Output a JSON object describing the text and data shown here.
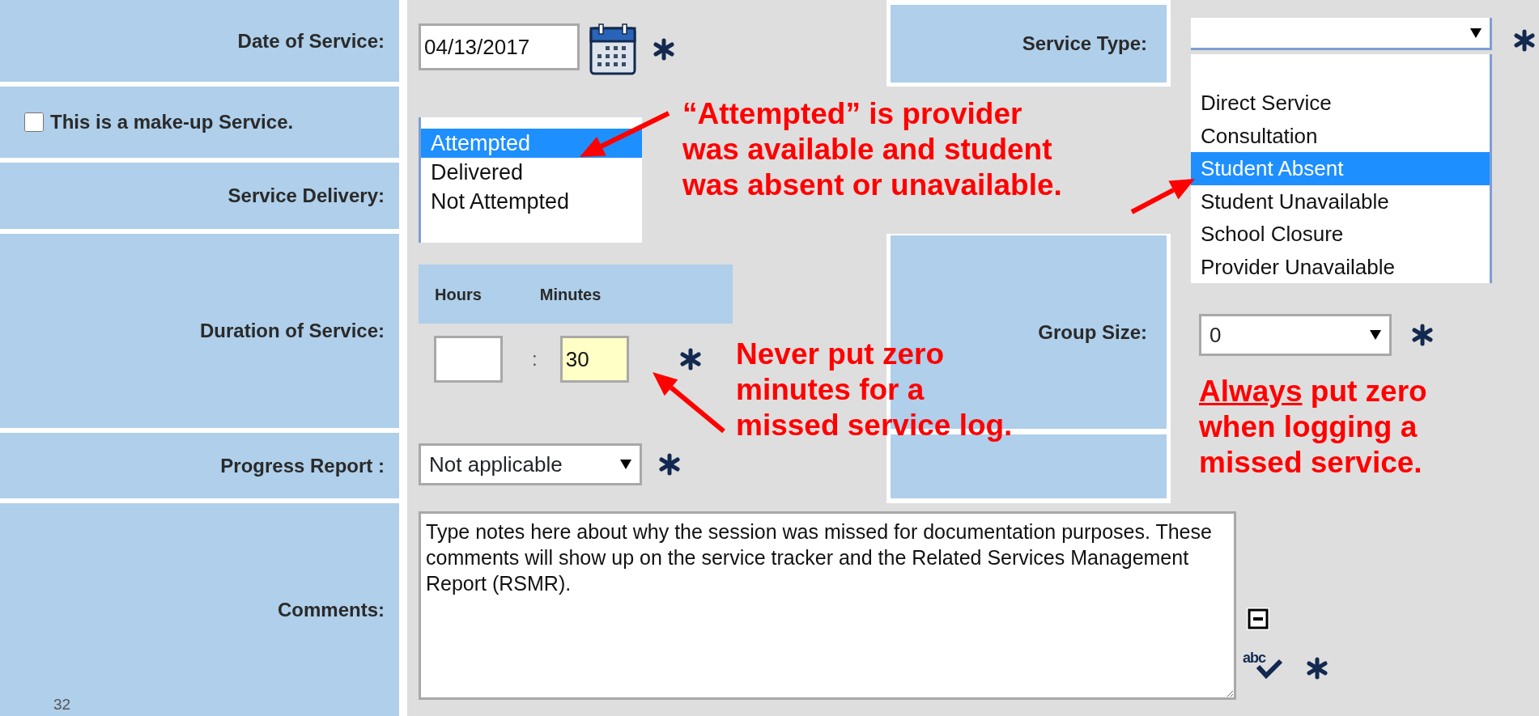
{
  "form": {
    "date_label": "Date of Service:",
    "date_value": "04/13/2017",
    "makeup": {
      "label": "This is a make-up Service.",
      "checked": false
    },
    "delivery_label": "Service Delivery:",
    "delivery_options": [
      {
        "label": "Attempted",
        "selected": true
      },
      {
        "label": "Delivered",
        "selected": false
      },
      {
        "label": "Not Attempted",
        "selected": false
      }
    ],
    "duration_label": "Duration of Service:",
    "hours_label": "Hours",
    "minutes_label": "Minutes",
    "separator": ":",
    "minutes_value": "30",
    "progress_label": "Progress Report :",
    "progress_value": "Not applicable",
    "comments_label": "Comments:",
    "comments_value": "Type notes here about why the session was missed for documentation purposes. These comments will show up on the service tracker and the Related Services Management Report (RSMR).",
    "spellcheck_label": "abc",
    "service_type_label": "Service Type:",
    "service_type_options": [
      {
        "label": "Direct Service",
        "selected": false
      },
      {
        "label": "Consultation",
        "selected": false
      },
      {
        "label": "Student Absent",
        "selected": true
      },
      {
        "label": "Student Unavailable",
        "selected": false
      },
      {
        "label": "School Closure",
        "selected": false
      },
      {
        "label": "Provider Unavailable",
        "selected": false
      }
    ],
    "group_size_label": "Group Size:",
    "group_size_value": "0"
  },
  "annotations": [
    {
      "lines": [
        "“Attempted” is provider",
        "was available and student",
        "was absent or unavailable."
      ]
    },
    {
      "lines": [
        "Never put zero",
        "minutes for a",
        "missed service log."
      ]
    },
    {
      "emphasis": "Always",
      "lines": [
        "put zero",
        "when logging a",
        "missed service."
      ]
    }
  ],
  "page_number": "32"
}
